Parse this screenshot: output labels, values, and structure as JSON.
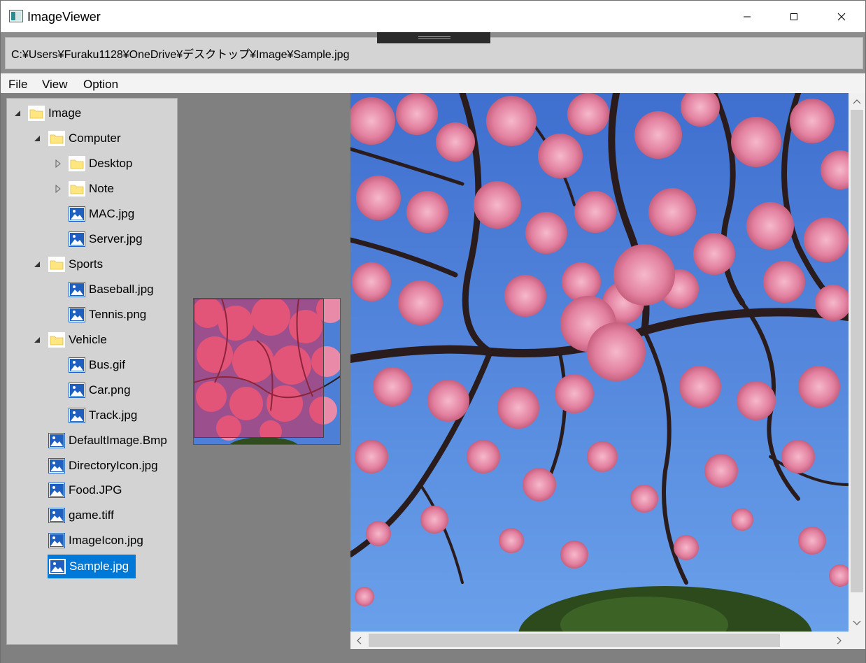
{
  "window": {
    "title": "ImageViewer",
    "icon": "image-viewer-app-icon"
  },
  "pathbar": {
    "path": "C:¥Users¥Furaku1128¥OneDrive¥デスクトップ¥Image¥Sample.jpg"
  },
  "menu": {
    "file": "File",
    "view": "View",
    "option": "Option"
  },
  "tree": {
    "root": "Image",
    "computer": "Computer",
    "desktop": "Desktop",
    "note": "Note",
    "mac": "MAC.jpg",
    "server": "Server.jpg",
    "sports": "Sports",
    "baseball": "Baseball.jpg",
    "tennis": "Tennis.png",
    "vehicle": "Vehicle",
    "bus": "Bus.gif",
    "car": "Car.png",
    "track": "Track.jpg",
    "default_image": "DefaultImage.Bmp",
    "directory_icon": "DirectoryIcon.jpg",
    "food": "Food.JPG",
    "game": "game.tiff",
    "image_icon": "ImageIcon.jpg",
    "sample": "Sample.jpg",
    "selected": "Sample.jpg"
  },
  "colors": {
    "selection": "#0078d7",
    "folder": "#ffe680",
    "image_icon": "#1e5fbf",
    "sky": "#4d7fd6",
    "blossom": "#e88aa8",
    "thumb_overlay": "#dc2850"
  }
}
